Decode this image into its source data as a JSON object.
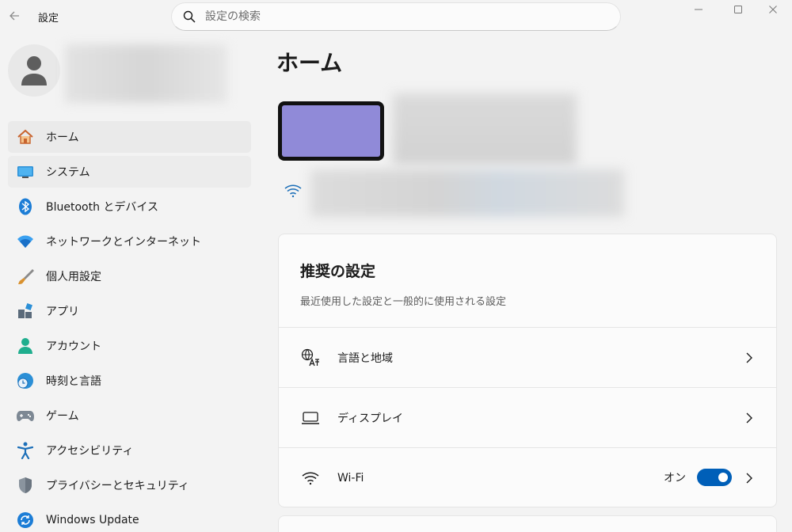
{
  "window": {
    "title": "設定",
    "back_icon": "back-arrow-icon",
    "controls": [
      "minimize-icon",
      "maximize-icon",
      "close-icon"
    ]
  },
  "search": {
    "placeholder": "設定の検索",
    "value": ""
  },
  "sidebar": {
    "items": [
      {
        "label": "ホーム",
        "icon": "home-icon",
        "active": true
      },
      {
        "label": "システム",
        "icon": "system-icon"
      },
      {
        "label": "Bluetooth とデバイス",
        "icon": "bluetooth-icon"
      },
      {
        "label": "ネットワークとインターネット",
        "icon": "network-icon"
      },
      {
        "label": "個人用設定",
        "icon": "brush-icon"
      },
      {
        "label": "アプリ",
        "icon": "apps-icon"
      },
      {
        "label": "アカウント",
        "icon": "account-icon"
      },
      {
        "label": "時刻と言語",
        "icon": "time-language-icon"
      },
      {
        "label": "ゲーム",
        "icon": "gamepad-icon"
      },
      {
        "label": "アクセシビリティ",
        "icon": "accessibility-icon"
      },
      {
        "label": "プライバシーとセキュリティ",
        "icon": "shield-icon"
      },
      {
        "label": "Windows Update",
        "icon": "update-icon"
      }
    ]
  },
  "main": {
    "title": "ホーム",
    "recommended": {
      "title": "推奨の設定",
      "subtitle": "最近使用した設定と一般的に使用される設定",
      "rows": [
        {
          "label": "言語と地域",
          "icon": "language-icon"
        },
        {
          "label": "ディスプレイ",
          "icon": "display-icon"
        },
        {
          "label": "Wi-Fi",
          "icon": "wifi-icon",
          "toggle_label": "オン",
          "toggle_on": true
        }
      ]
    }
  },
  "colors": {
    "accent": "#005fb8",
    "background": "#f3f3f3",
    "card": "#fbfbfb",
    "device_screen": "#908ad8"
  }
}
